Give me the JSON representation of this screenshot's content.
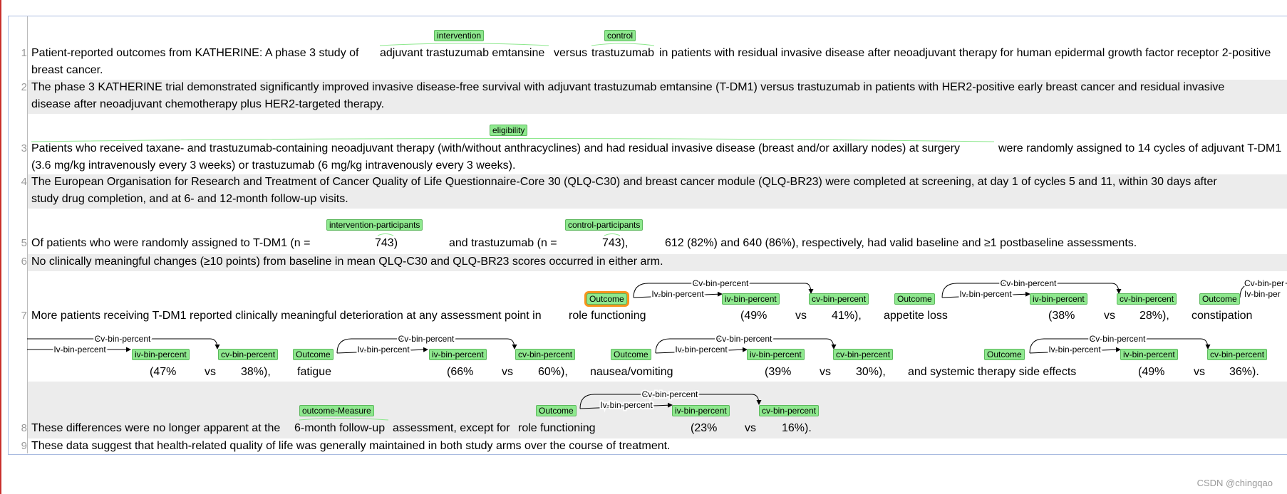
{
  "line_numbers": [
    "1",
    "2",
    "3",
    "4",
    "5",
    "6",
    "7",
    "8",
    "9"
  ],
  "rows": {
    "r1a": "Patient-reported outcomes from KATHERINE: A phase 3 study of",
    "r1b": "adjuvant trastuzumab emtansine",
    "r1c": "versus",
    "r1d": "trastuzumab",
    "r1e": "in patients with residual invasive disease after neoadjuvant therapy for human epidermal growth factor receptor 2-positive",
    "r1f": "breast cancer.",
    "r2a": "The phase 3 KATHERINE trial demonstrated significantly improved invasive disease-free survival with adjuvant trastuzumab emtansine (T-DM1) versus trastuzumab in patients with HER2-positive early breast cancer and residual invasive",
    "r2b": "disease after neoadjuvant chemotherapy plus HER2-targeted therapy.",
    "r3a": "Patients who received taxane- and trastuzumab-containing neoadjuvant therapy (with/without anthracyclines) and had residual invasive disease (breast and/or axillary nodes) at surgery",
    "r3b": "were randomly assigned to 14 cycles of adjuvant T-DM1",
    "r3c": "(3.6 mg/kg intravenously every 3 weeks) or trastuzumab (6 mg/kg intravenously every 3 weeks).",
    "r4a": "The European Organisation for Research and Treatment of Cancer Quality of Life Questionnaire-Core 30 (QLQ-C30) and breast cancer module (QLQ-BR23) were completed at screening, at day 1 of cycles 5 and 11, within 30 days after",
    "r4b": "study drug completion, and at 6- and 12-month follow-up visits.",
    "r5a": "Of patients who were randomly assigned to T-DM1 (n =",
    "r5b": "743)",
    "r5c": "and trastuzumab (n =",
    "r5d": "743),",
    "r5e": "612 (82%) and 640 (86%), respectively, had valid baseline and ≥1 postbaseline assessments.",
    "r6a": "No clinically meaningful changes (≥10 points) from baseline in mean QLQ-C30 and QLQ-BR23 scores occurred in either arm.",
    "r7a": "More patients receiving T-DM1 reported clinically meaningful deterioration at any assessment point in",
    "r7b": "role functioning",
    "r7c": "(49%",
    "r7d": "vs",
    "r7e": "41%),",
    "r7f": "appetite loss",
    "r7g": "(38%",
    "r7h": "vs",
    "r7i": "28%),",
    "r7j": "constipation",
    "r7k": "(47%",
    "r7l": "vs",
    "r7m": "38%),",
    "r7n": "fatigue",
    "r7o": "(66%",
    "r7p": "vs",
    "r7q": "60%),",
    "r7r": "nausea/vomiting",
    "r7s": "(39%",
    "r7t": "vs",
    "r7u": "30%),",
    "r7v": "and systemic therapy side effects",
    "r7w": "(49%",
    "r7x": "vs",
    "r7y": "36%).",
    "r8a": "These differences were no longer apparent at the",
    "r8b": "6-month follow-up",
    "r8c": "assessment, except for",
    "r8d": "role functioning",
    "r8e": "(23%",
    "r8f": "vs",
    "r8g": "16%).",
    "r9a": "These data suggest that health-related quality of life was generally maintained in both study arms over the course of treatment."
  },
  "tags": {
    "intervention": "intervention",
    "control": "control",
    "eligibility": "eligibility",
    "intervention_participants": "intervention-participants",
    "control_participants": "control-participants",
    "outcome": "Outcome",
    "iv_bin_percent": "iv-bin-percent",
    "cv_bin_percent": "cv-bin-percent",
    "outcome_measure": "outcome-Measure"
  },
  "relations": {
    "cv": "Cv-bin-percent",
    "iv": "Iv-bin-percent",
    "cv_cut": "Cv-bin-per",
    "iv_cut": "Iv-bin-per"
  },
  "watermark": "CSDN @chingqao",
  "colors": {
    "tag_bg": "#8ee88e",
    "selected": "#f7941d",
    "band": "#ececec"
  }
}
